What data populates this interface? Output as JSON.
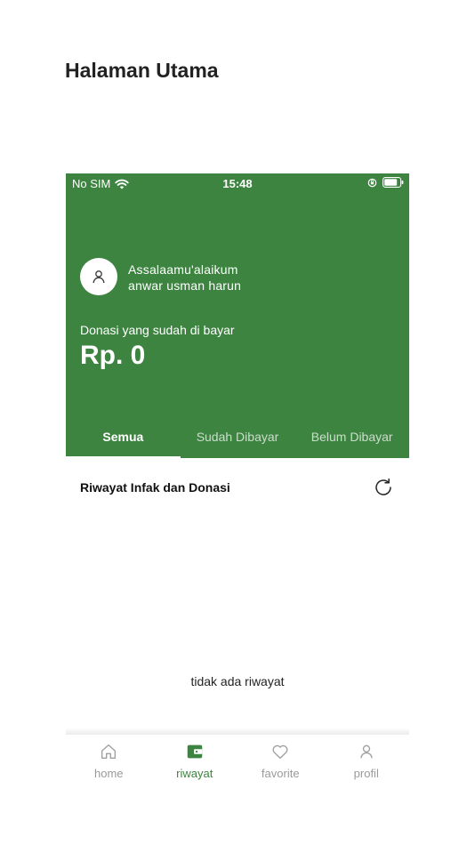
{
  "page": {
    "title": "Halaman Utama"
  },
  "status_bar": {
    "carrier": "No SIM",
    "time": "15:48"
  },
  "header": {
    "greeting_line1": "Assalaamu'alaikum",
    "greeting_line2": "anwar usman harun",
    "donasi_label": "Donasi yang sudah di bayar",
    "donasi_amount": "Rp. 0"
  },
  "tabs": [
    {
      "label": "Semua",
      "active": true
    },
    {
      "label": "Sudah Dibayar",
      "active": false
    },
    {
      "label": "Belum Dibayar",
      "active": false
    }
  ],
  "section": {
    "title": "Riwayat Infak dan Donasi"
  },
  "empty_state": "tidak ada riwayat",
  "bottom_nav": [
    {
      "label": "home",
      "icon": "home-icon",
      "active": false
    },
    {
      "label": "riwayat",
      "icon": "wallet-icon",
      "active": true
    },
    {
      "label": "favorite",
      "icon": "heart-icon",
      "active": false
    },
    {
      "label": "profil",
      "icon": "user-icon",
      "active": false
    }
  ],
  "colors": {
    "primary": "#3d8441",
    "inactive": "#9a9a9a"
  }
}
